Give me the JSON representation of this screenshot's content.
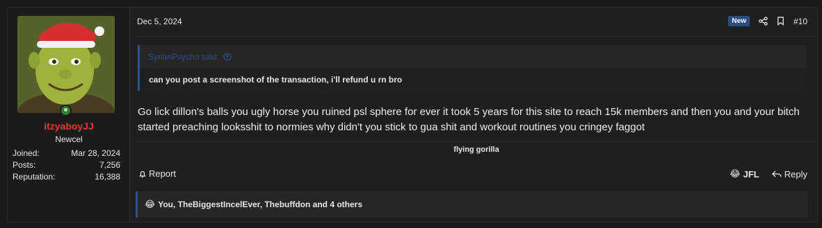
{
  "user": {
    "username": "itzyaboyJJ",
    "title": "Newcel",
    "stats": [
      {
        "label": "Joined:",
        "value": "Mar 28, 2024"
      },
      {
        "label": "Posts:",
        "value": "7,256"
      },
      {
        "label": "Reputation:",
        "value": "16,388"
      }
    ]
  },
  "post": {
    "date": "Dec 5, 2024",
    "badge": "New",
    "number": "#10",
    "quote_author": "SyrianPsycho said:",
    "quote_text": "can you post a screenshot of the transaction, i'll refund u rn bro",
    "message": "Go lick dillon's balls you ugly horse you ruined psl sphere for ever it took 5 years for this site to reach 15k members and then you and your bitch started preaching looksshit to normies why didn't you stick to gua shit and workout routines you cringey faggot",
    "signature": "flying gorilla"
  },
  "actions": {
    "report": "Report",
    "jfl": "JFL",
    "reply": "Reply"
  },
  "reactions": {
    "emoji": "😂",
    "text": "You, TheBiggestIncelEver, Thebuffdon and 4 others"
  },
  "colors": {
    "username": "#e23b2e",
    "quote_author": "#2f4f8f",
    "new_badge": "#2a4d85"
  },
  "icons": [
    "share-icon",
    "bookmark-icon",
    "arrow-up-circle-icon",
    "report-bell-icon",
    "reply-arrow-icon",
    "online-status-icon"
  ]
}
